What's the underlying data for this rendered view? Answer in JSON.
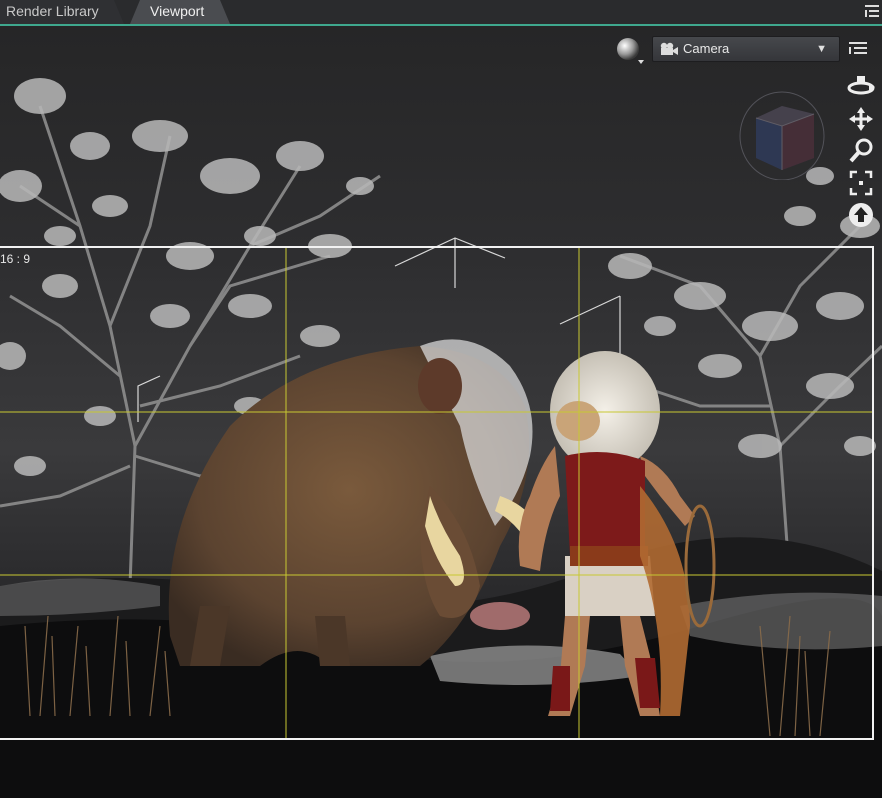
{
  "tabs": [
    {
      "label": "Render Library",
      "active": false
    },
    {
      "label": "Viewport",
      "active": true
    }
  ],
  "accent_color": "#3fa88e",
  "toolbar": {
    "shading_icon": "sphere-shading-icon",
    "camera": {
      "selected": "Camera",
      "icon": "camera-icon"
    },
    "menu_icon": "menu-lines-icon"
  },
  "nav_tools": [
    {
      "name": "orbit-icon"
    },
    {
      "name": "pan-icon"
    },
    {
      "name": "zoom-icon"
    },
    {
      "name": "frame-icon"
    },
    {
      "name": "reset-view-icon"
    }
  ],
  "viewport": {
    "aspect_label": "16 : 9",
    "guide_color": "#c8c832"
  }
}
